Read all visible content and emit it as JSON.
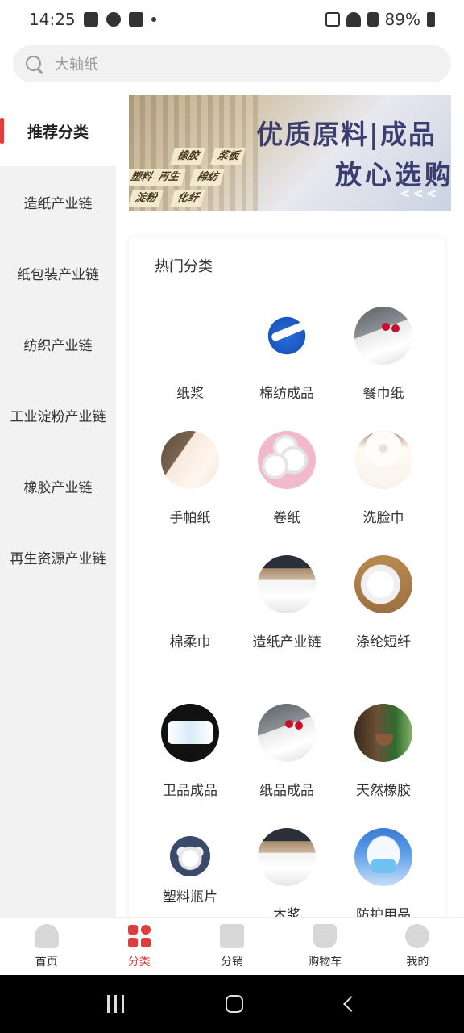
{
  "status_bar": {
    "time": "14:25",
    "battery": "89%"
  },
  "search": {
    "placeholder": "大轴纸"
  },
  "sidebar": {
    "items": [
      {
        "label": "推荐分类",
        "active": true
      },
      {
        "label": "造纸产业链"
      },
      {
        "label": "纸包装产业链"
      },
      {
        "label": "纺织产业链"
      },
      {
        "label": "工业淀粉产业链"
      },
      {
        "label": "橡胶产业链"
      },
      {
        "label": "再生资源产业链"
      }
    ]
  },
  "banner": {
    "title": "优质原料|成品",
    "subtitle": "放心选购",
    "arrows": "<<<",
    "tags": [
      "橡胶",
      "浆板",
      "再生",
      "棉纺",
      "淀粉",
      "化纤",
      "塑料"
    ]
  },
  "hot": {
    "title": "热门分类",
    "items": [
      {
        "label": "纸浆",
        "icon": "pulp-image"
      },
      {
        "label": "棉纺成品",
        "icon": "swoosh-logo-image"
      },
      {
        "label": "餐巾纸",
        "icon": "napkin-cherry-image"
      },
      {
        "label": "手帕纸",
        "icon": "handkerchief-paper-image"
      },
      {
        "label": "卷纸",
        "icon": "toilet-roll-image"
      },
      {
        "label": "洗脸巾",
        "icon": "face-towel-roll-image"
      },
      {
        "label": "棉柔巾",
        "icon": "cotton-towel-image"
      },
      {
        "label": "造纸产业链",
        "icon": "paper-stack-image"
      },
      {
        "label": "涤纶短纤",
        "icon": "polyester-fiber-image"
      },
      {
        "label": "卫品成品",
        "icon": "diaper-image"
      },
      {
        "label": "纸品成品",
        "icon": "napkin-cherry-image"
      },
      {
        "label": "天然橡胶",
        "icon": "rubber-tree-image"
      },
      {
        "label": "塑料瓶片",
        "icon": "plastic-pellets-image"
      },
      {
        "label": "木浆",
        "icon": "wood-pulp-image"
      },
      {
        "label": "防护用品",
        "icon": "face-mask-image"
      }
    ]
  },
  "bottom_nav": {
    "items": [
      {
        "label": "首页",
        "icon": "home-icon"
      },
      {
        "label": "分类",
        "icon": "category-icon",
        "active": true
      },
      {
        "label": "分销",
        "icon": "distribution-icon"
      },
      {
        "label": "购物车",
        "icon": "cart-icon"
      },
      {
        "label": "我的",
        "icon": "profile-icon"
      }
    ]
  },
  "colors": {
    "accent": "#e33b3b",
    "banner_text": "#3a3e6e"
  }
}
